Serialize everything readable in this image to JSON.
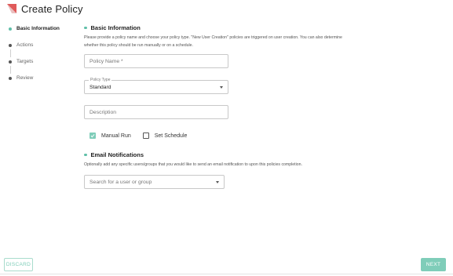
{
  "header": {
    "title": "Create Policy",
    "logo_color": "#e05a5a"
  },
  "stepper": {
    "steps": [
      {
        "label": "Basic Information",
        "active": true
      },
      {
        "label": "Actions",
        "active": false
      },
      {
        "label": "Targets",
        "active": false
      },
      {
        "label": "Review",
        "active": false
      }
    ]
  },
  "basic": {
    "title": "Basic Information",
    "description_line1": "Please provide a policy name and choose your policy type. \"New User Creation\" policies are triggered on user creation. You can also determine",
    "description_line2": "whether this policy should be run manually or on a schedule.",
    "policy_name_placeholder": "Policy Name *",
    "policy_type_label": "Policy Type",
    "policy_type_value": "Standard",
    "description_placeholder": "Description",
    "manual_run_label": "Manual Run",
    "manual_run_checked": true,
    "set_schedule_label": "Set Schedule",
    "set_schedule_checked": false
  },
  "email": {
    "title": "Email Notifications",
    "description": "Optionally add any specific users/groups that you would like to send an email notification to upon this policies completion.",
    "search_placeholder": "Search for a user or group"
  },
  "footer": {
    "discard_label": "DISCARD",
    "next_label": "NEXT"
  },
  "colors": {
    "accent": "#7fcdb9",
    "accent_dot": "#5fbfa8"
  }
}
